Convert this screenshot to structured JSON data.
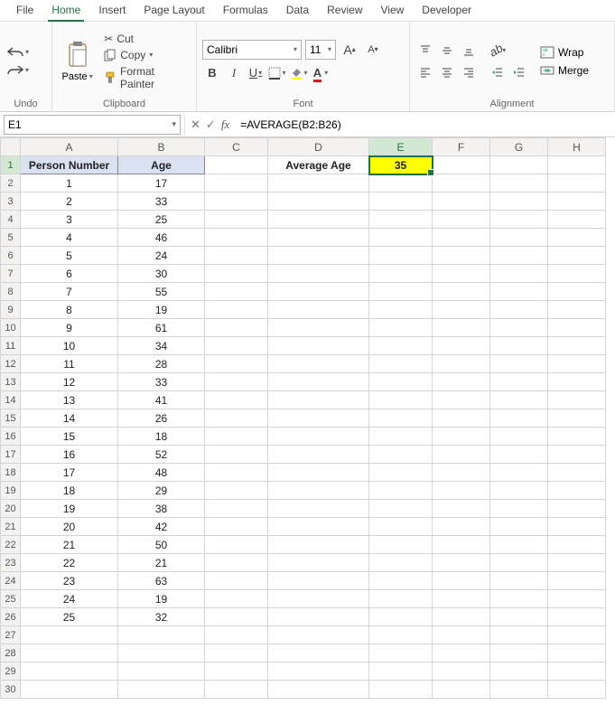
{
  "menu": {
    "items": [
      "File",
      "Home",
      "Insert",
      "Page Layout",
      "Formulas",
      "Data",
      "Review",
      "View",
      "Developer"
    ],
    "active": "Home"
  },
  "ribbon": {
    "undo_label": "Undo",
    "clipboard": {
      "paste": "Paste",
      "cut": "Cut",
      "copy": "Copy",
      "format_painter": "Format Painter",
      "label": "Clipboard"
    },
    "font": {
      "name": "Calibri",
      "size": "11",
      "label": "Font"
    },
    "alignment": {
      "wrap": "Wrap",
      "merge": "Merge",
      "label": "Alignment"
    }
  },
  "name_box": "E1",
  "formula": "=AVERAGE(B2:B26)",
  "columns": [
    "A",
    "B",
    "C",
    "D",
    "E",
    "F",
    "G",
    "H"
  ],
  "header_row": {
    "A": "Person Number",
    "B": "Age",
    "D": "Average Age",
    "E": "35"
  },
  "data_rows": [
    {
      "r": 1,
      "A": "Person Number",
      "B": "Age"
    },
    {
      "r": 2,
      "A": "1",
      "B": "17"
    },
    {
      "r": 3,
      "A": "2",
      "B": "33"
    },
    {
      "r": 4,
      "A": "3",
      "B": "25"
    },
    {
      "r": 5,
      "A": "4",
      "B": "46"
    },
    {
      "r": 6,
      "A": "5",
      "B": "24"
    },
    {
      "r": 7,
      "A": "6",
      "B": "30"
    },
    {
      "r": 8,
      "A": "7",
      "B": "55"
    },
    {
      "r": 9,
      "A": "8",
      "B": "19"
    },
    {
      "r": 10,
      "A": "9",
      "B": "61"
    },
    {
      "r": 11,
      "A": "10",
      "B": "34"
    },
    {
      "r": 12,
      "A": "11",
      "B": "28"
    },
    {
      "r": 13,
      "A": "12",
      "B": "33"
    },
    {
      "r": 14,
      "A": "13",
      "B": "41"
    },
    {
      "r": 15,
      "A": "14",
      "B": "26"
    },
    {
      "r": 16,
      "A": "15",
      "B": "18"
    },
    {
      "r": 17,
      "A": "16",
      "B": "52"
    },
    {
      "r": 18,
      "A": "17",
      "B": "48"
    },
    {
      "r": 19,
      "A": "18",
      "B": "29"
    },
    {
      "r": 20,
      "A": "19",
      "B": "38"
    },
    {
      "r": 21,
      "A": "20",
      "B": "42"
    },
    {
      "r": 22,
      "A": "21",
      "B": "50"
    },
    {
      "r": 23,
      "A": "22",
      "B": "21"
    },
    {
      "r": 24,
      "A": "23",
      "B": "63"
    },
    {
      "r": 25,
      "A": "24",
      "B": "19"
    },
    {
      "r": 26,
      "A": "25",
      "B": "32"
    }
  ],
  "total_rows": 30,
  "selected_cell": "E1",
  "chart_data": {
    "type": "table",
    "title": "Age data with computed average",
    "columns": [
      "Person Number",
      "Age"
    ],
    "rows": [
      [
        1,
        17
      ],
      [
        2,
        33
      ],
      [
        3,
        25
      ],
      [
        4,
        46
      ],
      [
        5,
        24
      ],
      [
        6,
        30
      ],
      [
        7,
        55
      ],
      [
        8,
        19
      ],
      [
        9,
        61
      ],
      [
        10,
        34
      ],
      [
        11,
        28
      ],
      [
        12,
        33
      ],
      [
        13,
        41
      ],
      [
        14,
        26
      ],
      [
        15,
        18
      ],
      [
        16,
        52
      ],
      [
        17,
        48
      ],
      [
        18,
        29
      ],
      [
        19,
        38
      ],
      [
        20,
        42
      ],
      [
        21,
        50
      ],
      [
        22,
        21
      ],
      [
        23,
        63
      ],
      [
        24,
        19
      ],
      [
        25,
        32
      ]
    ],
    "summary": {
      "label": "Average Age",
      "formula": "=AVERAGE(B2:B26)",
      "value": 35
    }
  }
}
